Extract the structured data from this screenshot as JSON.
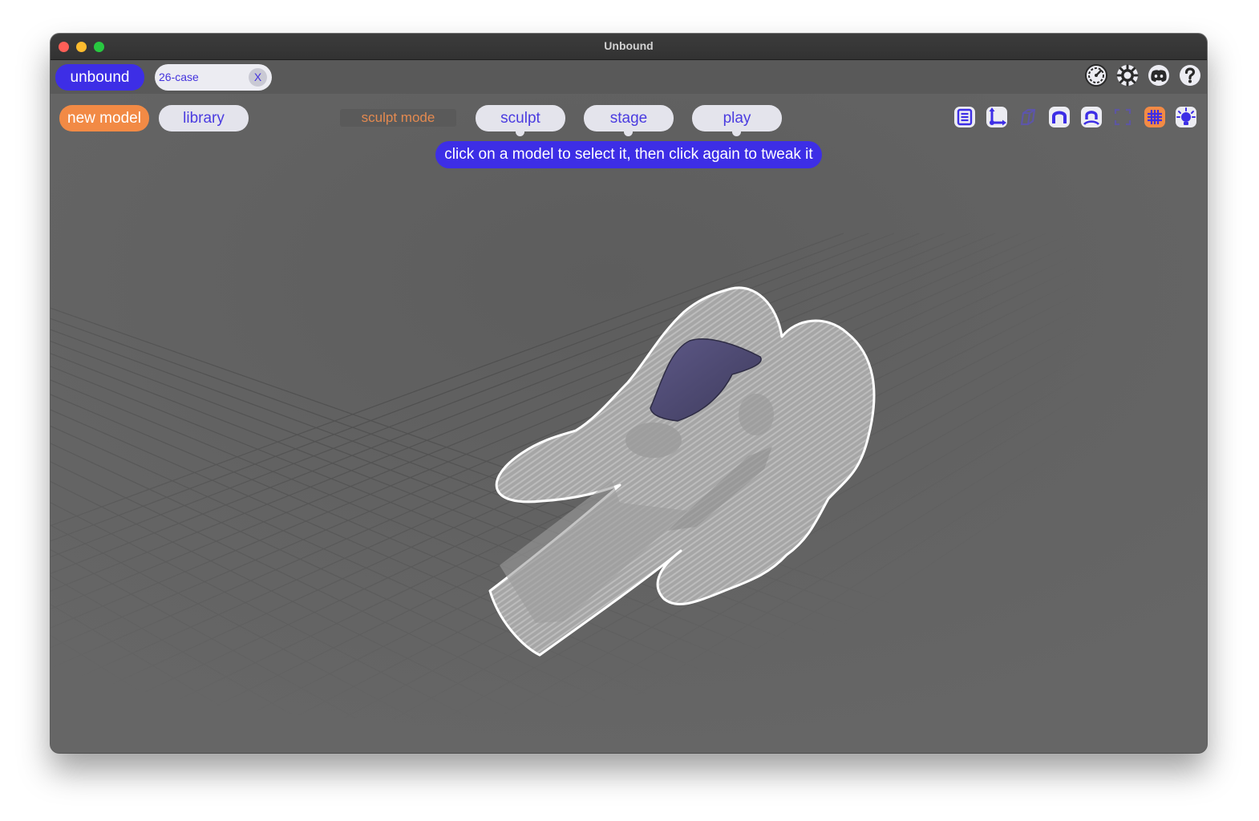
{
  "window": {
    "title": "Unbound"
  },
  "topbar": {
    "brand_label": "unbound",
    "document_tab": {
      "label": "26-case",
      "close_label": "X"
    },
    "right_icons": [
      "speedometer-icon",
      "gear-icon",
      "discord-icon",
      "help-icon"
    ]
  },
  "toolbar": {
    "new_model_label": "new model",
    "library_label": "library",
    "mode_label": "sculpt mode",
    "modes": [
      {
        "label": "sculpt"
      },
      {
        "label": "stage"
      },
      {
        "label": "play"
      }
    ],
    "tool_icons": [
      "list-icon",
      "axes-icon",
      "cube-outline-icon",
      "magnet-icon",
      "snap-magnet-icon",
      "frame-icon",
      "grid-icon",
      "light-icon"
    ]
  },
  "hint": {
    "text": "click on a model to select it, then click again to tweak it"
  },
  "colors": {
    "accent": "#3d2ee6",
    "orange": "#f28a45",
    "canvas": "#636363",
    "selection": "#4b4870"
  }
}
